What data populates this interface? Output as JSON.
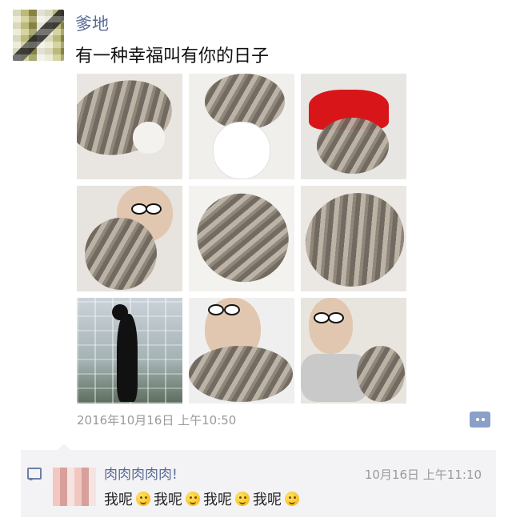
{
  "post": {
    "username": "爹地",
    "text": "有一种幸福叫有你的日子",
    "timestamp": "2016年10月16日 上午10:50",
    "photos": [
      {
        "name": "photo-cat-sleeping-with-toy"
      },
      {
        "name": "photo-cat-with-figurine"
      },
      {
        "name": "photo-cat-red-hat"
      },
      {
        "name": "photo-selfie-with-cat"
      },
      {
        "name": "photo-cat-curled"
      },
      {
        "name": "photo-cat-stretched"
      },
      {
        "name": "photo-cat-at-window"
      },
      {
        "name": "photo-man-with-cat"
      },
      {
        "name": "photo-man-on-sofa-with-cat"
      }
    ]
  },
  "comment": {
    "name": "肉肉肉肉肉!",
    "time": "10月16日 上午11:10",
    "parts": [
      "我呢",
      "我呢",
      "我呢",
      "我呢"
    ],
    "emoji": "smiley"
  },
  "colors": {
    "name_blue": "#5b6b96",
    "timestamp_gray": "#9a9a9a",
    "comment_bg": "#f3f3f5",
    "action_button": "#8aa0c7"
  }
}
